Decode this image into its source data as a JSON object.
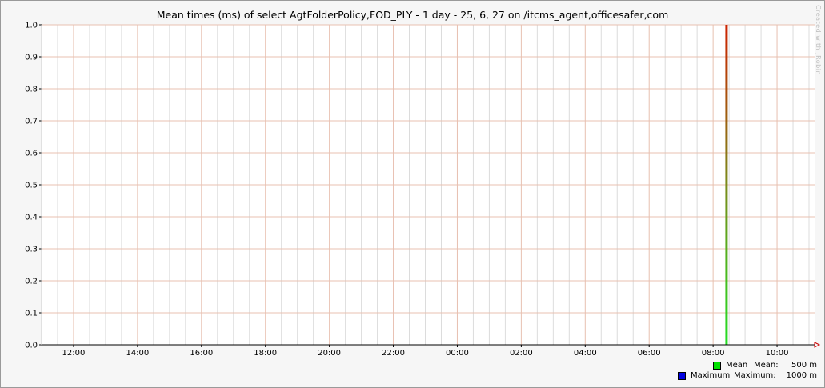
{
  "chart_data": {
    "type": "line",
    "title": "Mean times (ms) of select AgtFolderPolicy,FOD_PLY - 1 day - 25, 6, 27 on /itcms_agent,officesafer,com",
    "xlabel": "",
    "ylabel": "",
    "x_ticks": [
      "12:00",
      "14:00",
      "16:00",
      "18:00",
      "20:00",
      "22:00",
      "00:00",
      "02:00",
      "04:00",
      "06:00",
      "08:00",
      "10:00"
    ],
    "y_ticks": [
      "0.0",
      "0.1",
      "0.2",
      "0.3",
      "0.4",
      "0.5",
      "0.6",
      "0.7",
      "0.8",
      "0.9",
      "1.0"
    ],
    "x_range_hours": [
      11.0,
      35.2
    ],
    "ylim": [
      0,
      1
    ],
    "grid": true,
    "spike": {
      "time": "08:25",
      "hours": 32.42,
      "value": 1.0
    },
    "series": [
      {
        "name": "Mean",
        "stat_label": "Mean:",
        "stat_value": "500 m",
        "color": "#00e000"
      },
      {
        "name": "Maximum",
        "stat_label": "Maximum:",
        "stat_value": "1000 m",
        "color": "#0000e0"
      }
    ],
    "legend_position": "bottom-right",
    "watermark": "Created with JRobin"
  }
}
